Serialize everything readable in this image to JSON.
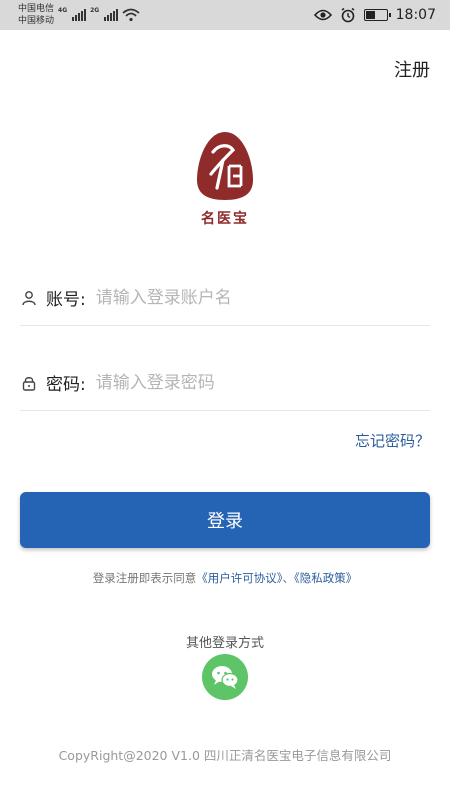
{
  "status_bar": {
    "carrier_1": "中国电信",
    "carrier_2": "中国移动",
    "net_1": "4G",
    "net_2": "2G",
    "time": "18:07"
  },
  "header": {
    "register_label": "注册"
  },
  "logo": {
    "text": "名医宝"
  },
  "account": {
    "label": "账号:",
    "placeholder": "请输入登录账户名"
  },
  "password": {
    "label": "密码:",
    "placeholder": "请输入登录密码"
  },
  "forgot_label": "忘记密码？",
  "login_label": "登录",
  "agreement": {
    "prefix": "登录注册即表示同意",
    "user_agreement": "《用户许可协议》",
    "separator": "、",
    "privacy_policy": "《隐私政策》"
  },
  "other_login": {
    "title": "其他登录方式",
    "wechat_icon": "wechat-icon"
  },
  "copyright": "CopyRight@2020 V1.0 四川正清名医宝电子信息有限公司",
  "colors": {
    "primary": "#2563b5",
    "brand": "#8f2b2b",
    "wechat": "#5dc468",
    "link": "#2b5e9c"
  }
}
